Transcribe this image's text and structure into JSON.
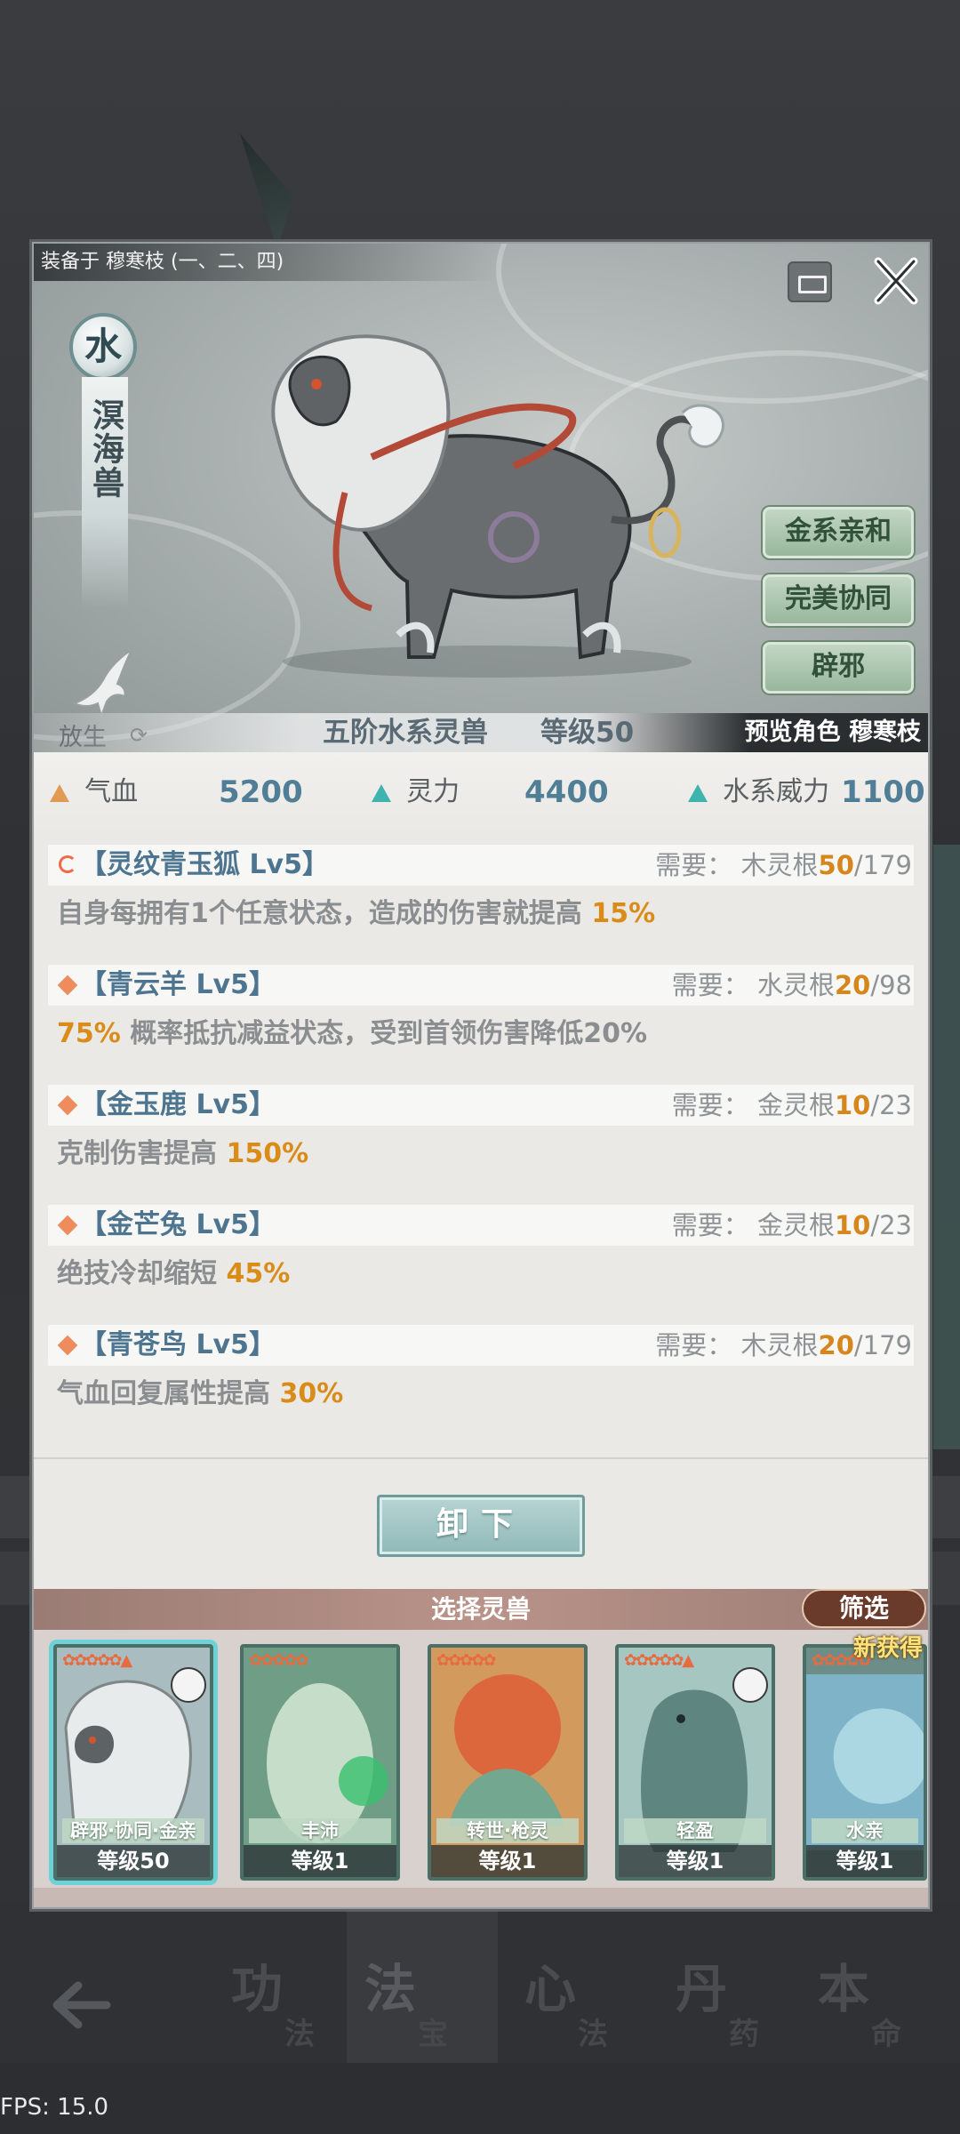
{
  "equipped": "装备于 穆寒枝 (一、二、四)",
  "element": "水",
  "beast_name": "溟海兽",
  "traits": [
    "金系亲和",
    "完美协同",
    "辟邪"
  ],
  "release": {
    "label": "放生"
  },
  "rank": "五阶水系灵兽",
  "level": "等级50",
  "preview": "预览角色 穆寒枝",
  "stats": [
    {
      "label": "气血",
      "value": "5200",
      "icon": "triangle-up-orange"
    },
    {
      "label": "灵力",
      "value": "4400",
      "icon": "triangle-up-teal"
    },
    {
      "label": "水系威力",
      "value": "1100",
      "icon": "triangle-up-teal"
    }
  ],
  "skills": [
    {
      "name": "【灵纹青玉狐 Lv5】",
      "req_prefix": "需要：  木灵根",
      "req_cur": "50",
      "req_max": "/179",
      "desc_pre": "自身每拥有1个任意状态，造成的伤害就提高 ",
      "desc_hl": "15%",
      "desc_post": "",
      "icon": "cycle-icon"
    },
    {
      "name": "【青云羊 Lv5】",
      "req_prefix": "需要：  水灵根",
      "req_cur": "20",
      "req_max": "/98",
      "desc_pre": "",
      "desc_hl": "75%",
      "desc_post": " 概率抵抗减益状态，受到首领伤害降低20%",
      "icon": "diamond-icon"
    },
    {
      "name": "【金玉鹿 Lv5】",
      "req_prefix": "需要：  金灵根",
      "req_cur": "10",
      "req_max": "/23",
      "desc_pre": "克制伤害提高 ",
      "desc_hl": "150%",
      "desc_post": "",
      "icon": "diamond-icon"
    },
    {
      "name": "【金芒兔 Lv5】",
      "req_prefix": "需要：  金灵根",
      "req_cur": "10",
      "req_max": "/23",
      "desc_pre": "绝技冷却缩短 ",
      "desc_hl": "45%",
      "desc_post": "",
      "icon": "diamond-icon"
    },
    {
      "name": "【青苍鸟 Lv5】",
      "req_prefix": "需要：  木灵根",
      "req_cur": "20",
      "req_max": "/179",
      "desc_pre": "气血回复属性提高 ",
      "desc_hl": "30%",
      "desc_post": "",
      "icon": "diamond-icon"
    }
  ],
  "unequip": "卸下",
  "select_title": "选择灵兽",
  "filter": "筛选",
  "new_badge": "新获得",
  "cards": [
    {
      "tag": "辟邪·协同·金亲",
      "level": "等级50",
      "stars": "✿✿✿✿✿▲",
      "selected": true
    },
    {
      "tag": "丰沛",
      "level": "等级1",
      "stars": "✿✿✿✿✿",
      "selected": false
    },
    {
      "tag": "转世·枪灵",
      "level": "等级1",
      "stars": "✿✿✿✿✿",
      "selected": false
    },
    {
      "tag": "轻盈",
      "level": "等级1",
      "stars": "✿✿✿✿✿▲",
      "selected": false
    },
    {
      "tag": "水亲",
      "level": "等级1",
      "stars": "✿✿✿✿✿",
      "selected": false
    }
  ],
  "nav": [
    {
      "big": "功",
      "small": "法"
    },
    {
      "big": "法",
      "small": "宝"
    },
    {
      "big": "心",
      "small": "法"
    },
    {
      "big": "丹",
      "small": "药"
    },
    {
      "big": "本",
      "small": "命"
    }
  ],
  "fps": "FPS: 15.0",
  "colors": {
    "accent_orange": "#da8c19",
    "stat_blue": "#4f7e96",
    "teal": "#3fb3ad",
    "filter_brown": "#6a3a2a"
  }
}
